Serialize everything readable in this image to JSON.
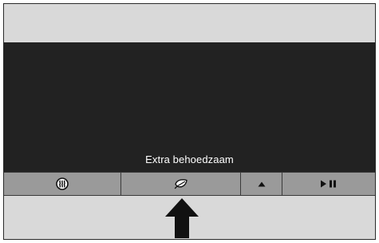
{
  "screen": {
    "status_label": "Extra behoedzaam"
  },
  "buttons": [
    {
      "name": "heat-mode",
      "icon": "heat-waves-icon"
    },
    {
      "name": "eco-mode",
      "icon": "leaf-icon"
    },
    {
      "name": "up",
      "icon": "triangle-up-icon"
    },
    {
      "name": "play-pause",
      "icon": "play-pause-icon"
    }
  ],
  "pointer": {
    "icon": "up-arrow-pointer-icon",
    "target": "eco-mode"
  }
}
